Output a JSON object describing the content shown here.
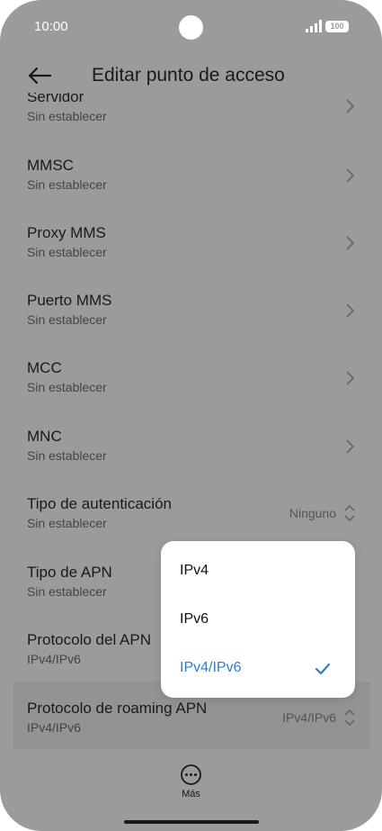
{
  "status": {
    "time": "10:00",
    "battery": "100"
  },
  "header": {
    "title": "Editar punto de acceso"
  },
  "rows": [
    {
      "label": "Servidor",
      "sub": "Sin establecer"
    },
    {
      "label": "MMSC",
      "sub": "Sin establecer"
    },
    {
      "label": "Proxy MMS",
      "sub": "Sin establecer"
    },
    {
      "label": "Puerto MMS",
      "sub": "Sin establecer"
    },
    {
      "label": "MCC",
      "sub": "Sin establecer"
    },
    {
      "label": "MNC",
      "sub": "Sin establecer"
    },
    {
      "label": "Tipo de autenticación",
      "sub": "Sin establecer",
      "value": "Ninguno"
    },
    {
      "label": "Tipo de APN",
      "sub": "Sin establecer"
    },
    {
      "label": "Protocolo del APN",
      "sub": "IPv4/IPv6"
    },
    {
      "label": "Protocolo de roaming APN",
      "sub": "IPv4/IPv6",
      "value": "IPv4/IPv6"
    }
  ],
  "popup": {
    "options": [
      "IPv4",
      "IPv6",
      "IPv4/IPv6"
    ],
    "selected": "IPv4/IPv6"
  },
  "bottom": {
    "more_label": "Más"
  },
  "colors": {
    "accent": "#2e7bd6",
    "background_dimmed": "#9b9b9b"
  }
}
